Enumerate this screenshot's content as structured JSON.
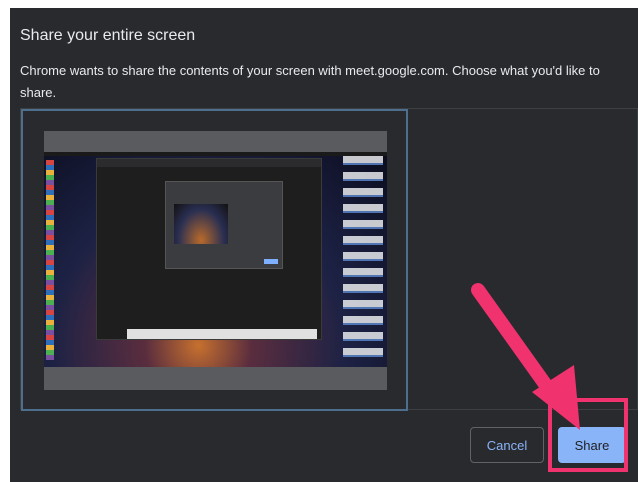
{
  "dialog": {
    "title": "Share your entire screen",
    "description": "Chrome wants to share the contents of your screen with meet.google.com. Choose what you'd like to share."
  },
  "buttons": {
    "cancel_label": "Cancel",
    "share_label": "Share"
  },
  "annotation": {
    "arrow_icon": "arrow-down-right-icon",
    "color": "#f0326f"
  },
  "colors": {
    "dialog_bg": "#292a2d",
    "accent": "#8ab4f8",
    "selection_border": "#4d6f8d"
  }
}
